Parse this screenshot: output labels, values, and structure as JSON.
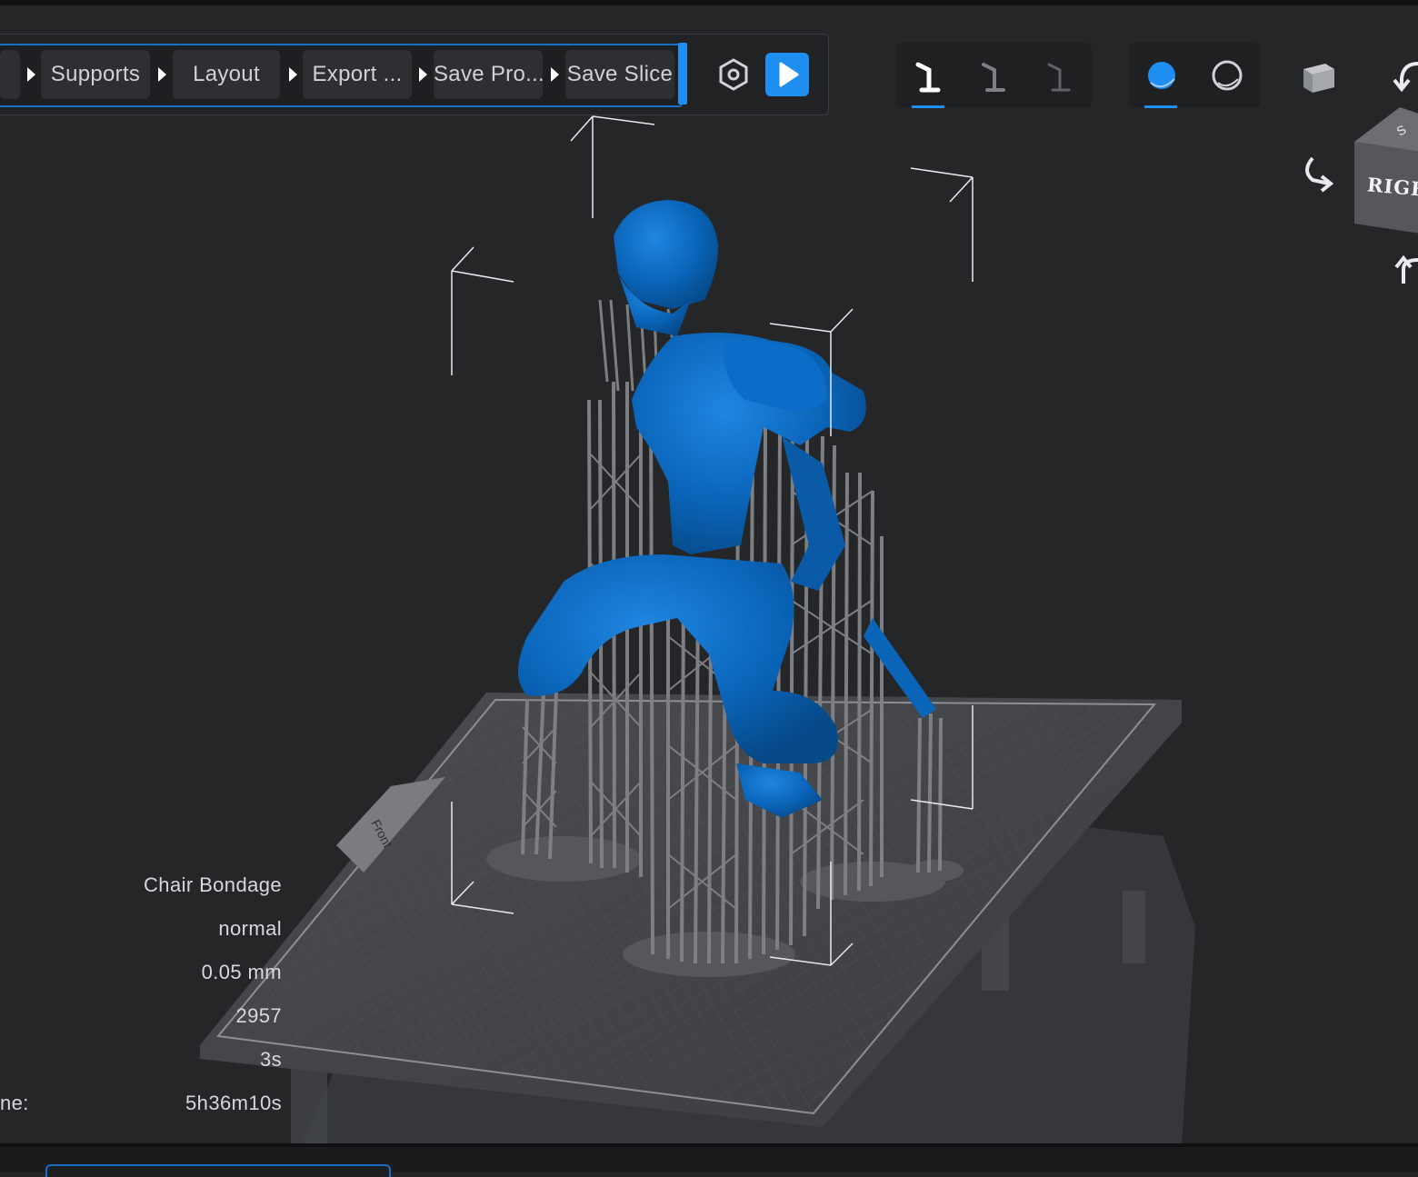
{
  "workflow": {
    "steps": [
      {
        "label": ""
      },
      {
        "label": "Supports"
      },
      {
        "label": "Layout"
      },
      {
        "label": "Export ..."
      },
      {
        "label": "Save Pro..."
      },
      {
        "label": "Save Slice"
      }
    ],
    "settings_icon": "gear-icon",
    "play_icon": "play-icon",
    "accent": "#1e8ff0"
  },
  "support_density_group": {
    "buttons": [
      "support-heavy-icon",
      "support-medium-icon",
      "support-light-icon"
    ],
    "active_index": 0
  },
  "render_mode_group": {
    "buttons": [
      "solid-shading-icon",
      "xray-shading-icon"
    ],
    "active_index": 0
  },
  "view_cube": {
    "face_label": "RIGHT"
  },
  "viewport": {
    "plate_label": "Front",
    "model_color": "#0a64b8",
    "support_color": "#7a7c80"
  },
  "info_panel": {
    "name": "Chair Bondage",
    "profile": "normal",
    "layer_height": "0.05 mm",
    "layers": "2957",
    "slice_time": "3s",
    "print_time_label": "Print time:",
    "print_time_label_visible": "ne:",
    "print_time": "5h36m10s"
  }
}
